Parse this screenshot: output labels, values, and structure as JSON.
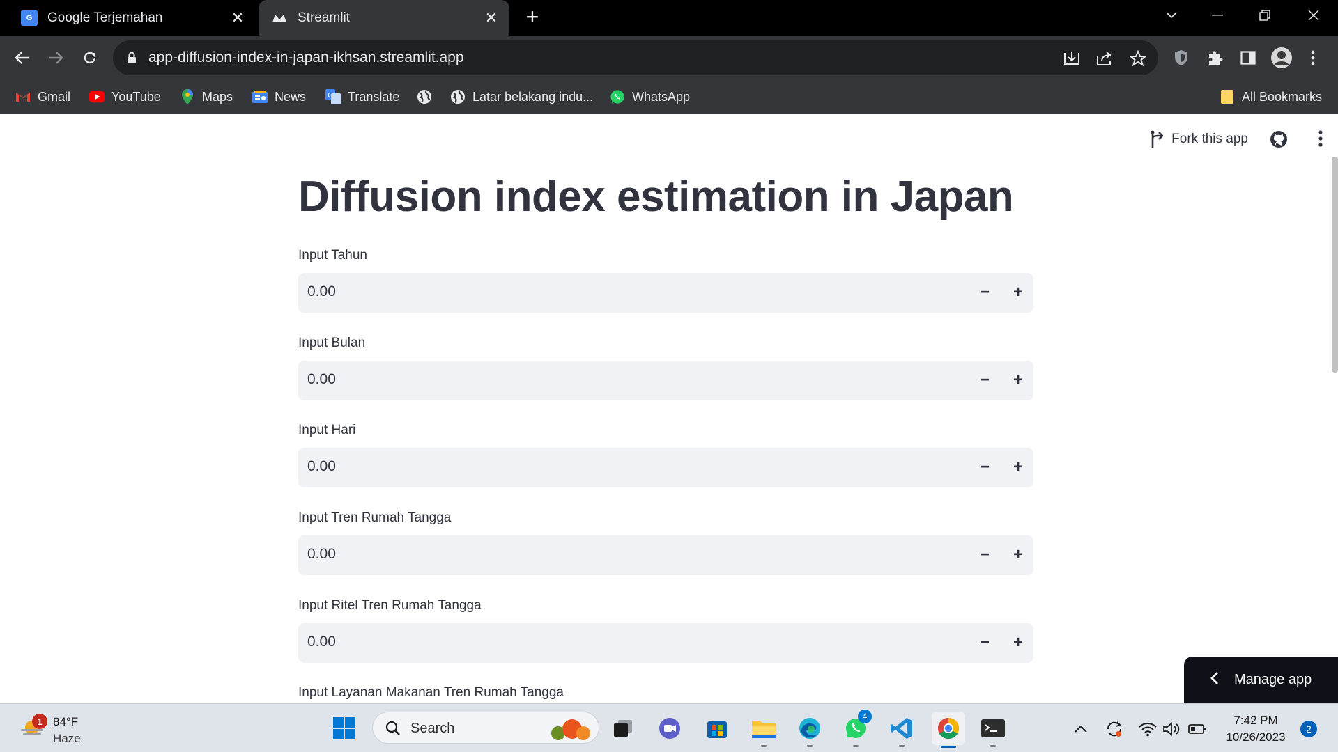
{
  "browser": {
    "tabs": [
      {
        "title": "Google Terjemahan",
        "icon": "google-translate-icon",
        "active": false
      },
      {
        "title": "Streamlit",
        "icon": "streamlit-icon",
        "active": true
      }
    ],
    "url": "app-diffusion-index-in-japan-ikhsan.streamlit.app",
    "bookmarks": [
      {
        "label": "Gmail",
        "icon": "gmail-icon"
      },
      {
        "label": "YouTube",
        "icon": "youtube-icon"
      },
      {
        "label": "Maps",
        "icon": "maps-icon"
      },
      {
        "label": "News",
        "icon": "news-icon"
      },
      {
        "label": "Translate",
        "icon": "translate-icon"
      },
      {
        "label": "",
        "icon": "globe-icon"
      },
      {
        "label": "Latar belakang indu...",
        "icon": "globe-icon"
      },
      {
        "label": "WhatsApp",
        "icon": "whatsapp-icon"
      }
    ],
    "all_bookmarks_label": "All Bookmarks"
  },
  "app": {
    "fork_label": "Fork this app",
    "title": "Diffusion index estimation in Japan",
    "fields": [
      {
        "label": "Input Tahun",
        "value": "0.00"
      },
      {
        "label": "Input Bulan",
        "value": "0.00"
      },
      {
        "label": "Input Hari",
        "value": "0.00"
      },
      {
        "label": "Input Tren Rumah Tangga",
        "value": "0.00"
      },
      {
        "label": "Input Ritel Tren Rumah Tangga",
        "value": "0.00"
      },
      {
        "label": "Input Layanan Makanan Tren Rumah Tangga",
        "value": ""
      }
    ],
    "minus_symbol": "−",
    "plus_symbol": "+",
    "manage_label": "Manage app"
  },
  "taskbar": {
    "weather_temp": "84°F",
    "weather_cond": "Haze",
    "weather_badge": "1",
    "search_placeholder": "Search",
    "whatsapp_badge": "4",
    "time": "7:42 PM",
    "date": "10/26/2023",
    "notification_count": "2"
  },
  "colors": {
    "accent": "#ff4b4b",
    "input_bg": "#f0f2f6",
    "text": "#31333f",
    "manage_bg": "#0e1117"
  }
}
